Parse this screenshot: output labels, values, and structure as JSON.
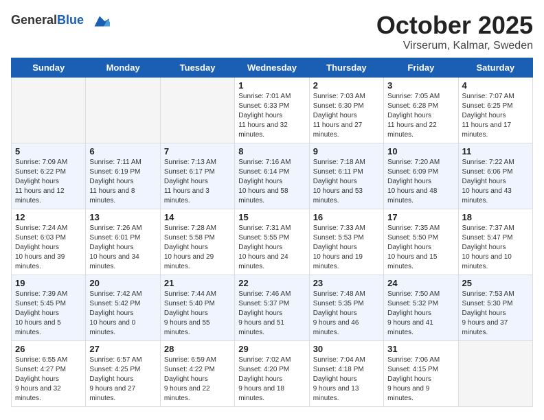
{
  "header": {
    "logo_general": "General",
    "logo_blue": "Blue",
    "month": "October 2025",
    "location": "Virserum, Kalmar, Sweden"
  },
  "weekdays": [
    "Sunday",
    "Monday",
    "Tuesday",
    "Wednesday",
    "Thursday",
    "Friday",
    "Saturday"
  ],
  "weeks": [
    [
      {
        "day": "",
        "empty": true
      },
      {
        "day": "",
        "empty": true
      },
      {
        "day": "",
        "empty": true
      },
      {
        "day": "1",
        "sunrise": "7:01 AM",
        "sunset": "6:33 PM",
        "daylight": "11 hours and 32 minutes."
      },
      {
        "day": "2",
        "sunrise": "7:03 AM",
        "sunset": "6:30 PM",
        "daylight": "11 hours and 27 minutes."
      },
      {
        "day": "3",
        "sunrise": "7:05 AM",
        "sunset": "6:28 PM",
        "daylight": "11 hours and 22 minutes."
      },
      {
        "day": "4",
        "sunrise": "7:07 AM",
        "sunset": "6:25 PM",
        "daylight": "11 hours and 17 minutes."
      }
    ],
    [
      {
        "day": "5",
        "sunrise": "7:09 AM",
        "sunset": "6:22 PM",
        "daylight": "11 hours and 12 minutes."
      },
      {
        "day": "6",
        "sunrise": "7:11 AM",
        "sunset": "6:19 PM",
        "daylight": "11 hours and 8 minutes."
      },
      {
        "day": "7",
        "sunrise": "7:13 AM",
        "sunset": "6:17 PM",
        "daylight": "11 hours and 3 minutes."
      },
      {
        "day": "8",
        "sunrise": "7:16 AM",
        "sunset": "6:14 PM",
        "daylight": "10 hours and 58 minutes."
      },
      {
        "day": "9",
        "sunrise": "7:18 AM",
        "sunset": "6:11 PM",
        "daylight": "10 hours and 53 minutes."
      },
      {
        "day": "10",
        "sunrise": "7:20 AM",
        "sunset": "6:09 PM",
        "daylight": "10 hours and 48 minutes."
      },
      {
        "day": "11",
        "sunrise": "7:22 AM",
        "sunset": "6:06 PM",
        "daylight": "10 hours and 43 minutes."
      }
    ],
    [
      {
        "day": "12",
        "sunrise": "7:24 AM",
        "sunset": "6:03 PM",
        "daylight": "10 hours and 39 minutes."
      },
      {
        "day": "13",
        "sunrise": "7:26 AM",
        "sunset": "6:01 PM",
        "daylight": "10 hours and 34 minutes."
      },
      {
        "day": "14",
        "sunrise": "7:28 AM",
        "sunset": "5:58 PM",
        "daylight": "10 hours and 29 minutes."
      },
      {
        "day": "15",
        "sunrise": "7:31 AM",
        "sunset": "5:55 PM",
        "daylight": "10 hours and 24 minutes."
      },
      {
        "day": "16",
        "sunrise": "7:33 AM",
        "sunset": "5:53 PM",
        "daylight": "10 hours and 19 minutes."
      },
      {
        "day": "17",
        "sunrise": "7:35 AM",
        "sunset": "5:50 PM",
        "daylight": "10 hours and 15 minutes."
      },
      {
        "day": "18",
        "sunrise": "7:37 AM",
        "sunset": "5:47 PM",
        "daylight": "10 hours and 10 minutes."
      }
    ],
    [
      {
        "day": "19",
        "sunrise": "7:39 AM",
        "sunset": "5:45 PM",
        "daylight": "10 hours and 5 minutes."
      },
      {
        "day": "20",
        "sunrise": "7:42 AM",
        "sunset": "5:42 PM",
        "daylight": "10 hours and 0 minutes."
      },
      {
        "day": "21",
        "sunrise": "7:44 AM",
        "sunset": "5:40 PM",
        "daylight": "9 hours and 55 minutes."
      },
      {
        "day": "22",
        "sunrise": "7:46 AM",
        "sunset": "5:37 PM",
        "daylight": "9 hours and 51 minutes."
      },
      {
        "day": "23",
        "sunrise": "7:48 AM",
        "sunset": "5:35 PM",
        "daylight": "9 hours and 46 minutes."
      },
      {
        "day": "24",
        "sunrise": "7:50 AM",
        "sunset": "5:32 PM",
        "daylight": "9 hours and 41 minutes."
      },
      {
        "day": "25",
        "sunrise": "7:53 AM",
        "sunset": "5:30 PM",
        "daylight": "9 hours and 37 minutes."
      }
    ],
    [
      {
        "day": "26",
        "sunrise": "6:55 AM",
        "sunset": "4:27 PM",
        "daylight": "9 hours and 32 minutes."
      },
      {
        "day": "27",
        "sunrise": "6:57 AM",
        "sunset": "4:25 PM",
        "daylight": "9 hours and 27 minutes."
      },
      {
        "day": "28",
        "sunrise": "6:59 AM",
        "sunset": "4:22 PM",
        "daylight": "9 hours and 22 minutes."
      },
      {
        "day": "29",
        "sunrise": "7:02 AM",
        "sunset": "4:20 PM",
        "daylight": "9 hours and 18 minutes."
      },
      {
        "day": "30",
        "sunrise": "7:04 AM",
        "sunset": "4:18 PM",
        "daylight": "9 hours and 13 minutes."
      },
      {
        "day": "31",
        "sunrise": "7:06 AM",
        "sunset": "4:15 PM",
        "daylight": "9 hours and 9 minutes."
      },
      {
        "day": "",
        "empty": true
      }
    ]
  ]
}
